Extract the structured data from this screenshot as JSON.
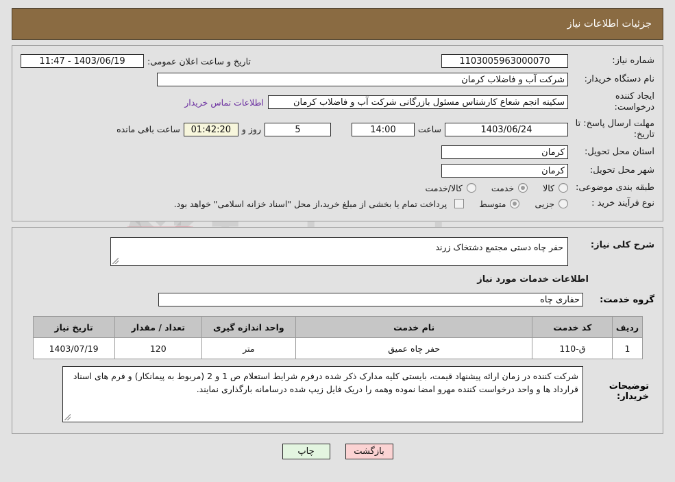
{
  "header": {
    "title": "جزئیات اطلاعات نیاز"
  },
  "watermark": {
    "brand": "AriaTender.net",
    "bottom": "AriaTender"
  },
  "top_form": {
    "need_number": {
      "label": "شماره نیاز:",
      "value": "1103005963000070"
    },
    "announce_datetime": {
      "label": "تاریخ و ساعت اعلان عمومی:",
      "value": "1403/06/19 - 11:47"
    },
    "buyer_org": {
      "label": "نام دستگاه خریدار:",
      "value": "شرکت آب و فاضلاب کرمان"
    },
    "request_creator": {
      "label": "ایجاد کننده درخواست:",
      "value": "سکینه انجم شعاع کارشناس مسئول بازرگانی شرکت آب و فاضلاب کرمان",
      "contact_link": "اطلاعات تماس خریدار"
    },
    "deadline": {
      "label": "مهلت ارسال پاسخ: تا تاریخ:",
      "date": "1403/06/24",
      "time_label": "ساعت",
      "time": "14:00",
      "days": "5",
      "days_label": "روز و",
      "remaining": "01:42:20",
      "remaining_label": "ساعت باقی مانده"
    },
    "delivery_province": {
      "label": "استان محل تحویل:",
      "value": "کرمان"
    },
    "delivery_city": {
      "label": "شهر محل تحویل:",
      "value": "کرمان"
    },
    "category": {
      "label": "طبقه بندی موضوعی:",
      "options": [
        {
          "label": "کالا",
          "selected": false
        },
        {
          "label": "خدمت",
          "selected": true
        },
        {
          "label": "کالا/خدمت",
          "selected": false
        }
      ]
    },
    "process_type": {
      "label": "نوع فرآیند خرید :",
      "options": [
        {
          "label": "جزیی",
          "selected": false
        },
        {
          "label": "متوسط",
          "selected": true
        }
      ],
      "checkbox_note": "پرداخت تمام یا بخشی از مبلغ خرید،از محل \"اسناد خزانه اسلامی\" خواهد بود.",
      "checkbox_checked": false
    }
  },
  "middle": {
    "general_desc": {
      "label": "شرح کلی نیاز:",
      "value": "حفر چاه دستی مجتمع دشتخاک زرند"
    },
    "services_section_title": "اطلاعات خدمات مورد نیاز",
    "service_group": {
      "label": "گروه خدمت:",
      "value": "حفاری چاه"
    }
  },
  "table": {
    "headers": [
      "ردیف",
      "کد خدمت",
      "نام خدمت",
      "واحد اندازه گیری",
      "تعداد / مقدار",
      "تاریخ نیاز"
    ],
    "rows": [
      {
        "radif": "1",
        "code": "ق-110",
        "name": "حفر چاه عمیق",
        "unit": "متر",
        "qty": "120",
        "date": "1403/07/19"
      }
    ]
  },
  "notes": {
    "label": "توضیحات خریدار:",
    "value": "شرکت کننده در زمان ارائه پیشنهاد قیمت، بایستی کلیه مدارک ذکر شده درفرم شرایط استعلام ص 1  و  2 (مربوط به پیمانکار) و فرم های اسناد قرارداد ها و واحد درخواست کننده مهرو امضا نموده وهمه را دریک فایل زیپ شده درسامانه بارگذاری نمایند."
  },
  "footer": {
    "print_label": "چاپ",
    "back_label": "بازگشت"
  },
  "colors": {
    "header_bg": "#8a6b42",
    "page_bg": "#e2e2e2",
    "link": "#6b2fa0",
    "highlight_field": "#f7f6dc",
    "btn_back": "#fbd3d3",
    "btn_print": "#e3f5e0",
    "table_header": "#c6c6c6"
  }
}
